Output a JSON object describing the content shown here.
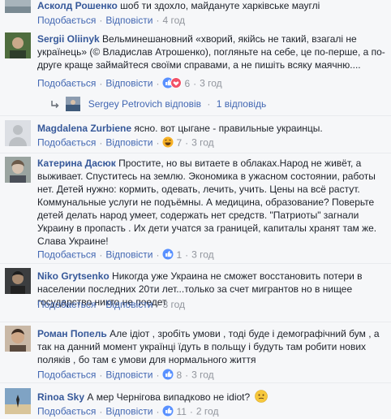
{
  "actions": {
    "like": "Подобається",
    "reply": "Відповісти"
  },
  "comments": [
    {
      "author": "Асколд Рошенко",
      "text": " шоб ти здохло, майдануте харківське мауглі",
      "time": "4 год",
      "reactions": null
    },
    {
      "author": "Sergii Oliinyk",
      "text": " Вельминешановний «хворий, якійсь не такий, взагалі не українець» (© Владислав Атрошенко), погляньте на себе, це по-перше, а по-друге краще займайтеся своїми справами, а не пишіть всяку маячню....",
      "time": "3 год",
      "reactions": {
        "count": "6",
        "types": [
          "like",
          "love"
        ]
      }
    },
    {
      "author": "Magdalena Zurbiene",
      "text": " ясно. вот цыгане - правильные украинцы.",
      "time": "3 год",
      "reactions": {
        "count": "7",
        "types": [
          "haha"
        ]
      }
    },
    {
      "author": "Катерина Дасюк",
      "text": " Простите, но вы витаете в облаках.Народ не живёт, а выживает. Спуститесь на землю. Экономика в ужасном состоянии, работы нет. Детей нужно: кормить, одевать, лечить, учить. Цены на всё растут. Коммунальные услуги не подъёмны. А медицина, образование? Поверьте детей делать народ умеет, содержать нет средств. \"Патриоты\" загнали Украину в пропасть . Их дети учатся за границей, капиталы хранят там же. Слава Украине!",
      "time": "3 год",
      "reactions": {
        "count": "1",
        "types": [
          "like"
        ]
      }
    },
    {
      "author": "Niko Grytsenko",
      "text": " Никогда уже Украина не сможет восстановить потери в населении последних 20ти лет...только за счет мигрантов но в нищее государство никто не поедет",
      "time": "3 год",
      "reactions": null
    },
    {
      "author": "Роман Попель",
      "text": " Але ідіот , зробіть умови , тоді буде і демографічний бум , а так на данний момент українці їдуть в польщу і будуть там робити нових поляків , бо там є умови для нормального життя",
      "time": "3 год",
      "reactions": {
        "count": "8",
        "types": [
          "like"
        ]
      }
    },
    {
      "author": "Rinoa Sky",
      "text": " А мер Чернігова випадково не idiot?",
      "time": "2 год",
      "reactions": {
        "count": "11",
        "types": [
          "like"
        ]
      }
    }
  ],
  "reply_summary": {
    "author": "Sergey Petrovich",
    "verb": "відповів",
    "count_label": "1 відповідь"
  },
  "colors": {
    "link": "#365899",
    "action": "#4267b2",
    "meta": "#90949c",
    "like": "#5890ff",
    "love": "#f25268",
    "haha": "#f7b125"
  }
}
